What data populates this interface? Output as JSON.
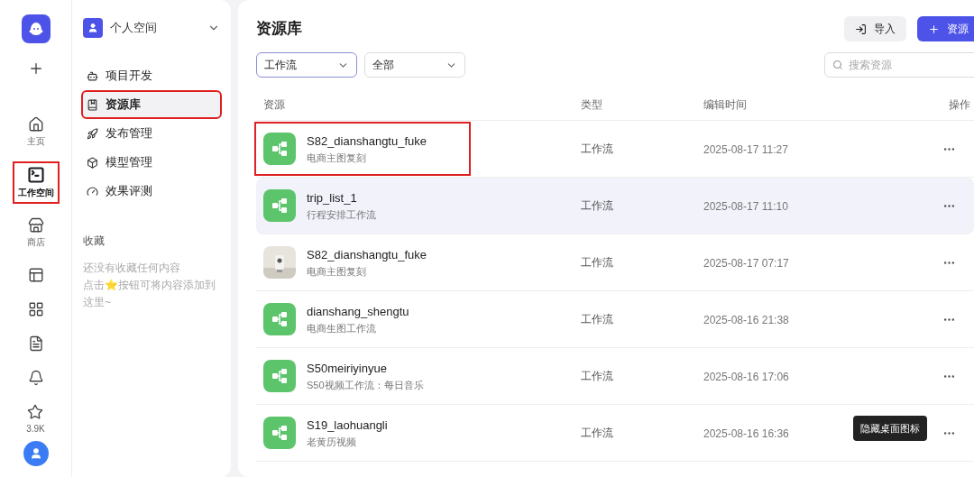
{
  "rail": {
    "items": [
      {
        "kind": "create",
        "selected": false,
        "annotated": false
      },
      {
        "kind": "home",
        "label": "主页",
        "selected": false,
        "annotated": false
      },
      {
        "kind": "workspace",
        "label": "工作空间",
        "selected": true,
        "annotated": true
      },
      {
        "kind": "store",
        "label": "商店",
        "selected": false,
        "annotated": false
      },
      {
        "kind": "layout",
        "selected": false,
        "annotated": false
      },
      {
        "kind": "apps",
        "selected": false,
        "annotated": false
      },
      {
        "kind": "doc",
        "selected": false,
        "annotated": false
      },
      {
        "kind": "bell",
        "selected": false,
        "annotated": false
      },
      {
        "kind": "star",
        "label": "3.9K",
        "selected": false,
        "annotated": false
      }
    ]
  },
  "sidebar": {
    "space": "个人空间",
    "items": [
      {
        "kind": "project",
        "label": "项目开发",
        "selected": false,
        "annotated": false
      },
      {
        "kind": "library",
        "label": "资源库",
        "selected": true,
        "annotated": true
      },
      {
        "kind": "publish",
        "label": "发布管理",
        "selected": false,
        "annotated": false
      },
      {
        "kind": "model",
        "label": "模型管理",
        "selected": false,
        "annotated": false
      },
      {
        "kind": "eval",
        "label": "效果评测",
        "selected": false,
        "annotated": false
      }
    ],
    "favorites_title": "收藏",
    "favorites_empty": [
      "还没有收藏任何内容",
      "点击⭐按钮可将内容添加到这里~"
    ]
  },
  "main": {
    "title": "资源库",
    "import_button": "导入",
    "add_button": "资源",
    "filters": [
      {
        "value": "工作流",
        "selected": true
      },
      {
        "value": "全部",
        "selected": false
      }
    ],
    "search": {
      "placeholder": "搜索资源"
    },
    "columns": [
      "资源",
      "类型",
      "编辑时间",
      "操作"
    ],
    "rows": [
      {
        "kind": "workflow",
        "name": "S82_dianshangtu_fuke",
        "desc": "电商主图复刻",
        "type": "工作流",
        "time": "2025-08-17 11:27",
        "selected": false,
        "annotated": true
      },
      {
        "kind": "workflow",
        "name": "trip_list_1",
        "desc": "行程安排工作流",
        "type": "工作流",
        "time": "2025-08-17 11:10",
        "selected": true,
        "annotated": false
      },
      {
        "kind": "picture",
        "name": "S82_dianshangtu_fuke",
        "desc": "电商主图复刻",
        "type": "工作流",
        "time": "2025-08-17 07:17",
        "selected": false,
        "annotated": false
      },
      {
        "kind": "workflow",
        "name": "dianshang_shengtu",
        "desc": "电商生图工作流",
        "type": "工作流",
        "time": "2025-08-16 21:38",
        "selected": false,
        "annotated": false
      },
      {
        "kind": "workflow",
        "name": "S50meiriyinyue",
        "desc": "S50视频工作流：每日音乐",
        "type": "工作流",
        "time": "2025-08-16 17:06",
        "selected": false,
        "annotated": false
      },
      {
        "kind": "workflow",
        "name": "S19_laohuangli",
        "desc": "老黄历视频",
        "type": "工作流",
        "time": "2025-08-16 16:36",
        "selected": false,
        "annotated": false
      }
    ]
  },
  "tooltip": "隐藏桌面图标"
}
